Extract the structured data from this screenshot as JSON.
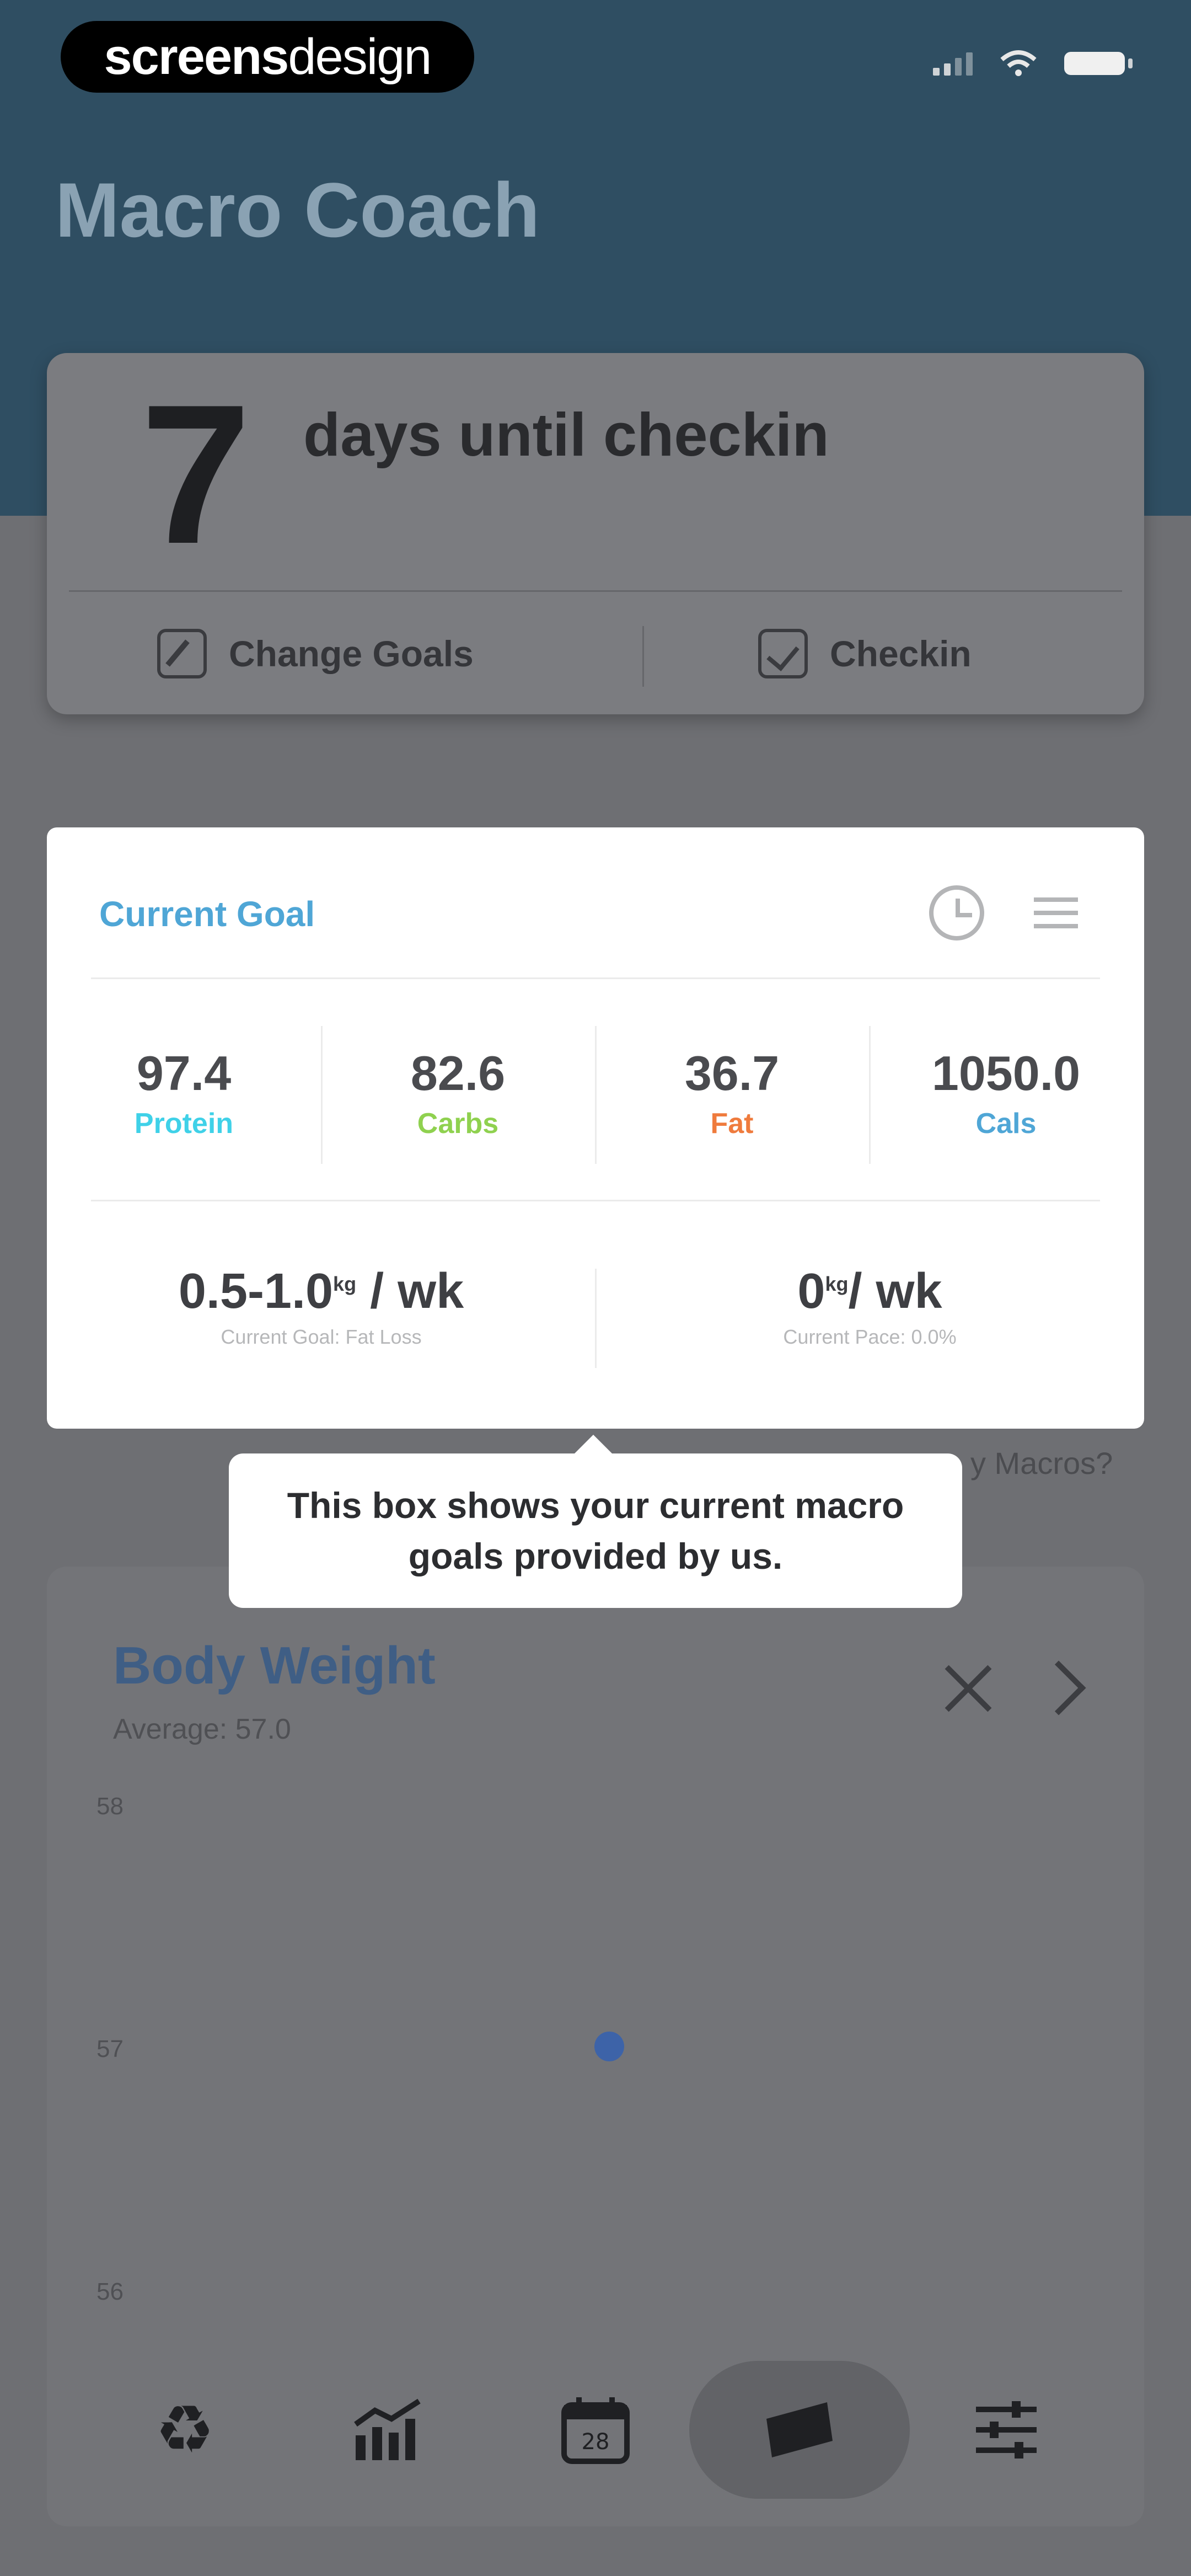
{
  "status_bar": {
    "brand": "screensdesign",
    "brand_bold": "screens",
    "brand_light": "design"
  },
  "header": {
    "title": "Macro Coach"
  },
  "checkin_card": {
    "days": "7",
    "days_label": "days until checkin",
    "change_goals_label": "Change Goals",
    "checkin_label": "Checkin"
  },
  "goal_card": {
    "title": "Current Goal",
    "macros": [
      {
        "value": "97.4",
        "label": "Protein",
        "color": "#3fd1e8"
      },
      {
        "value": "82.6",
        "label": "Carbs",
        "color": "#8fd14f"
      },
      {
        "value": "36.7",
        "label": "Fat",
        "color": "#ef7b3d"
      },
      {
        "value": "1050.0",
        "label": "Cals",
        "color": "#4fa6d6"
      }
    ],
    "pace": [
      {
        "value": "0.5-1.0",
        "unit": "kg",
        "suffix": " / wk",
        "sub": "Current Goal: Fat Loss"
      },
      {
        "value": "0",
        "unit": "kg",
        "suffix": "/ wk",
        "sub": "Current Pace: 0.0%"
      }
    ]
  },
  "tooltip": {
    "text_line1": "This box shows your current macro",
    "text_line2": "goals provided by us."
  },
  "background_link": "y Macros?",
  "body_weight": {
    "title": "Body Weight",
    "average": "Average: 57.0",
    "ticks": [
      "58",
      "57",
      "56"
    ]
  },
  "chart_data": {
    "type": "scatter",
    "title": "Body Weight",
    "subtitle": "Average: 57.0",
    "ylim": [
      56,
      58
    ],
    "yticks": [
      "58",
      "57",
      "56"
    ],
    "series": [
      {
        "points": [
          {
            "x": 1,
            "y": 57
          }
        ]
      }
    ]
  },
  "nav": [
    {
      "icon": "recycle-icon",
      "glyph": "♻"
    },
    {
      "icon": "chart-icon",
      "glyph": "📶"
    },
    {
      "icon": "calendar-icon",
      "glyph": "📅"
    },
    {
      "icon": "weight-icon",
      "glyph": "▰"
    },
    {
      "icon": "settings-icon",
      "glyph": "☰"
    }
  ]
}
